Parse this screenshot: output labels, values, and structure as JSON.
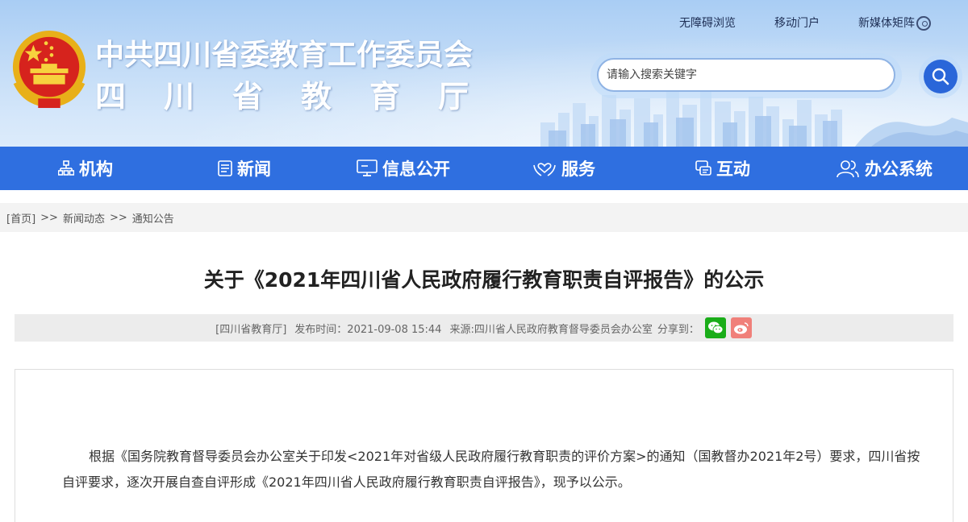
{
  "header": {
    "title_line1": "中共四川省委教育工作委员会",
    "title_line2": "四川省教育厅",
    "links": [
      "无障碍浏览",
      "移动门户",
      "新媒体矩阵"
    ],
    "search_placeholder": "请输入搜索关键字"
  },
  "nav": {
    "items": [
      {
        "label": "机构",
        "icon": "org-chart-icon"
      },
      {
        "label": "新闻",
        "icon": "news-icon"
      },
      {
        "label": "信息公开",
        "icon": "monitor-icon"
      },
      {
        "label": "服务",
        "icon": "service-hands-icon"
      },
      {
        "label": "互动",
        "icon": "interaction-icon"
      },
      {
        "label": "办公系统",
        "icon": "users-icon"
      }
    ]
  },
  "breadcrumb": {
    "items": [
      "[首页]",
      "新闻动态",
      "通知公告"
    ],
    "separator": ">>"
  },
  "article": {
    "title": "关于《2021年四川省人民政府履行教育职责自评报告》的公示",
    "meta": {
      "site": "[四川省教育厅]",
      "publish_time": "发布时间：2021-09-08 15:44",
      "source": "来源:四川省人民政府教育督导委员会办公室",
      "share_label": "分享到："
    },
    "paragraph": "根据《国务院教育督导委员会办公室关于印发<2021年对省级人民政府履行教育职责的评价方案>的通知（国教督办2021年2号）要求，四川省按自评要求，逐次开展自查自评形成《2021年四川省人民政府履行教育职责自评报告》，现予以公示。"
  },
  "colors": {
    "nav_bg": "#2f6fe0",
    "search_button": "#2a66d9",
    "wechat": "#1aad19",
    "weibo": "#f0807a"
  }
}
